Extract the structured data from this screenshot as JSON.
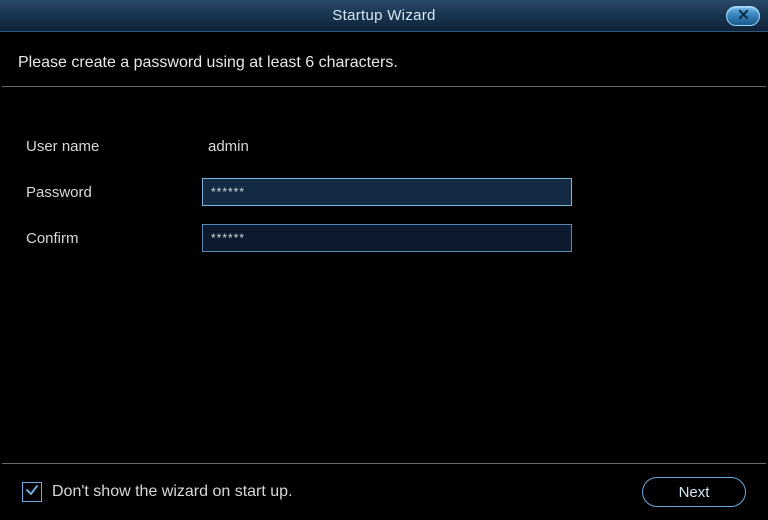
{
  "titlebar": {
    "title": "Startup Wizard"
  },
  "instruction": "Please create a password using at least 6 characters.",
  "form": {
    "username_label": "User name",
    "username_value": "admin",
    "password_label": "Password",
    "password_value": "******",
    "confirm_label": "Confirm",
    "confirm_value": "******"
  },
  "footer": {
    "checkbox_checked": true,
    "checkbox_label": "Don't show the wizard on start up.",
    "next_label": "Next"
  }
}
